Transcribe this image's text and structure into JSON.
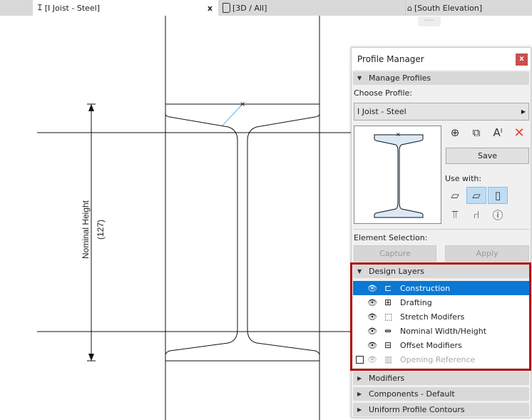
{
  "tabs": [
    {
      "label": "[I Joist - Steel]",
      "icon": "i-beam-icon",
      "active": true,
      "close": "x"
    },
    {
      "label": "[3D / All]",
      "icon": "3d-box-icon"
    },
    {
      "label": "[South Elevation]",
      "icon": "house-icon"
    }
  ],
  "canvas": {
    "dimension_label": "Nominal Height",
    "dimension_value": "(127)",
    "pill": "----"
  },
  "panel": {
    "title": "Profile Manager",
    "close": "x",
    "manage": {
      "header": "Manage Profiles",
      "choose_label": "Choose Profile:",
      "profile": "I Joist - Steel",
      "save": "Save",
      "use_with": "Use with:"
    },
    "element_selection": {
      "label": "Element Selection:",
      "capture": "Capture",
      "apply": "Apply"
    },
    "design_layers": {
      "header": "Design Layers",
      "items": [
        {
          "label": "Construction",
          "selected": true
        },
        {
          "label": "Drafting"
        },
        {
          "label": "Stretch Modifers"
        },
        {
          "label": "Nominal Width/Height"
        },
        {
          "label": "Offset Modifiers"
        },
        {
          "label": "Opening Reference",
          "disabled": true
        }
      ]
    },
    "sections": [
      "Modifiers",
      "Components - Default",
      "Uniform Profile Contours"
    ]
  },
  "colors": {
    "accent": "#0a78d4",
    "highlight": "#b01010",
    "close": "#c9504e"
  }
}
